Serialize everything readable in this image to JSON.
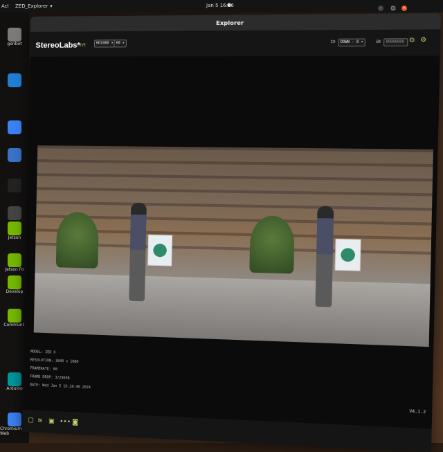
{
  "desktop": {
    "topbar": {
      "activities": "Activities",
      "app_menu": "ZED_Explorer",
      "app_menu_arrow": "▾",
      "clock": "Jan 5  16:26",
      "notification": "●"
    },
    "dock": [
      {
        "label": "genbot",
        "icon": "folder-icon",
        "color": "#7a7a7a"
      },
      {
        "label": "",
        "icon": "vscode-icon",
        "color": "#1e7fd4"
      },
      {
        "label": "",
        "icon": "chromium-icon",
        "color": "#3b82f6"
      },
      {
        "label": "",
        "icon": "app-icon",
        "color": "#3a72c8"
      },
      {
        "label": "",
        "icon": "obs-icon",
        "color": "#222222"
      },
      {
        "label": "",
        "icon": "terminal-icon",
        "color": "#444444"
      },
      {
        "label": "Jetson",
        "icon": "nvidia-icon",
        "color": "#76b900"
      },
      {
        "label": "Jetson Fo",
        "icon": "nvidia-icon",
        "color": "#76b900"
      },
      {
        "label": "Develop",
        "icon": "nvidia-icon",
        "color": "#76b900"
      },
      {
        "label": "Communit",
        "icon": "nvidia-icon",
        "color": "#76b900"
      },
      {
        "label": "Arduino",
        "icon": "arduino-icon",
        "color": "#00979d"
      },
      {
        "label": "Chromium Web",
        "icon": "chromium-icon",
        "color": "#3b82f6"
      }
    ]
  },
  "window": {
    "title": "Explorer",
    "brand": "StereoLabs",
    "brand_mark": "*",
    "live": "LIVE",
    "resolution": "HD1080",
    "fps": "60",
    "io_label": "IO",
    "device": "DOWN - 0",
    "sn_label": "SN",
    "serial": "00000000",
    "info": {
      "model": "MODEL: ZED X",
      "resolution": "RESOLUTION: 3840 x 1080",
      "framerate": "FRAMERATE: 60",
      "frame_drop": "FRAME DROP: 3/29698",
      "date": "DATE: Wed Jan 5 16:26:40 2024"
    },
    "version": "V4.1.2"
  }
}
